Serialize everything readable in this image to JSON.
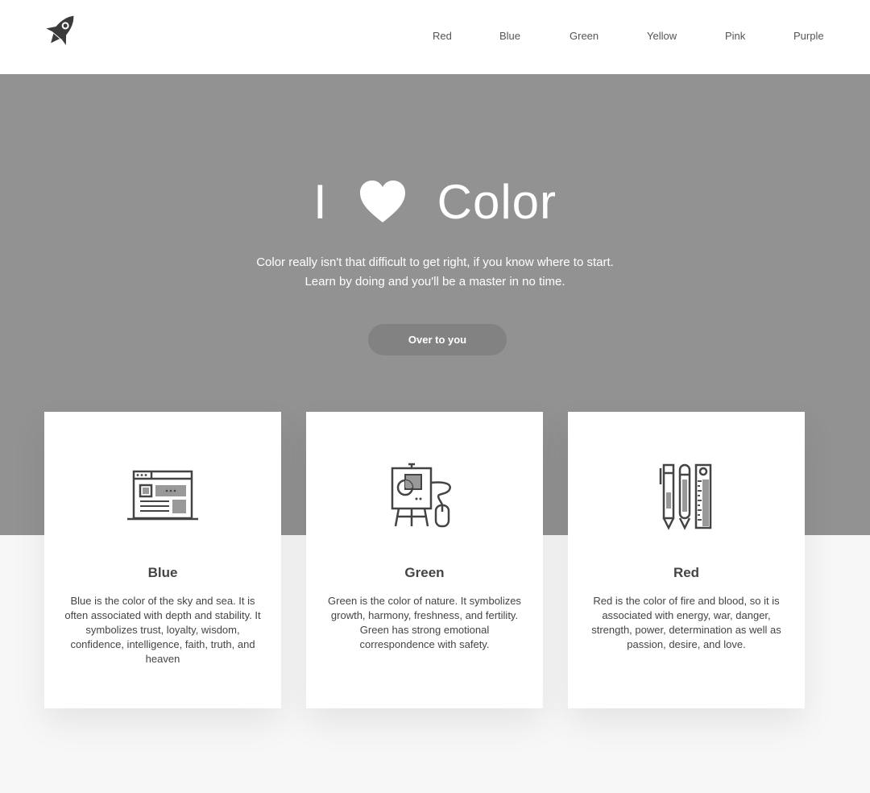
{
  "header": {
    "logo_icon": "rocket-icon",
    "nav": [
      {
        "label": "Red"
      },
      {
        "label": "Blue"
      },
      {
        "label": "Green"
      },
      {
        "label": "Yellow"
      },
      {
        "label": "Pink"
      },
      {
        "label": "Purple"
      }
    ]
  },
  "hero": {
    "title_left": "I",
    "title_icon": "heart-icon",
    "title_right": "Color",
    "subtitle_line1": "Color really isn't that difficult to get right, if you know where to start.",
    "subtitle_line2": "Learn by doing and you'll be a master in no time.",
    "cta_label": "Over to you"
  },
  "cards": [
    {
      "icon": "browser-window-icon",
      "title": "Blue",
      "text": "Blue is the color of the sky and sea. It is often associated with depth and stability. It symbolizes trust, loyalty, wisdom, confidence, intelligence, faith, truth, and heaven"
    },
    {
      "icon": "easel-mouse-icon",
      "title": "Green",
      "text": "Green is the color of nature. It symbolizes growth, harmony, freshness, and fertility. Green has strong emotional correspondence with safety."
    },
    {
      "icon": "pens-ruler-icon",
      "title": "Red",
      "text": "Red is the color of fire and blood, so it is associated with energy, war, danger, strength, power, determination as well as passion, desire, and love."
    }
  ],
  "colors": {
    "hero_bg": "#929292",
    "cta_bg": "#828282",
    "page_bg": "#f7f7f7",
    "card_bg": "#ffffff"
  }
}
